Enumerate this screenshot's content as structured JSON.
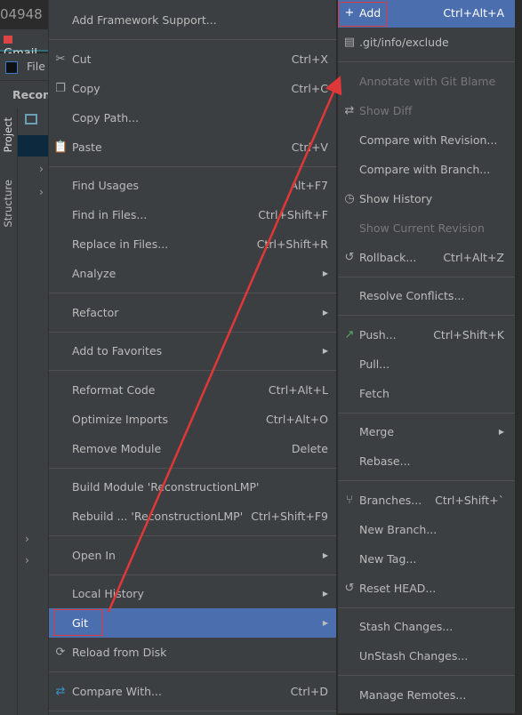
{
  "background": {
    "window_title_fragment": "04948",
    "browser_tab": "Gmail",
    "menubar_file": "File",
    "project_header": "Recons",
    "side_tab_project": "Project",
    "side_tab_structure": "Structure",
    "tree_root_fragment": "P"
  },
  "context_menu": {
    "items": [
      {
        "label": "Add Framework Support..."
      },
      {
        "sep": true
      },
      {
        "label": "Cut",
        "shortcut": "Ctrl+X",
        "icon": "scissors-icon",
        "glyph": "✂"
      },
      {
        "label": "Copy",
        "shortcut": "Ctrl+C",
        "icon": "copy-icon",
        "glyph": "❐"
      },
      {
        "label": "Copy Path..."
      },
      {
        "label": "Paste",
        "shortcut": "Ctrl+V",
        "icon": "clipboard-icon",
        "glyph": "📋"
      },
      {
        "sep": true
      },
      {
        "label": "Find Usages",
        "shortcut": "Alt+F7"
      },
      {
        "label": "Find in Files...",
        "shortcut": "Ctrl+Shift+F"
      },
      {
        "label": "Replace in Files...",
        "shortcut": "Ctrl+Shift+R"
      },
      {
        "label": "Analyze",
        "submenu": true
      },
      {
        "sep": true
      },
      {
        "label": "Refactor",
        "submenu": true
      },
      {
        "sep": true
      },
      {
        "label": "Add to Favorites",
        "submenu": true
      },
      {
        "sep": true
      },
      {
        "label": "Reformat Code",
        "shortcut": "Ctrl+Alt+L"
      },
      {
        "label": "Optimize Imports",
        "shortcut": "Ctrl+Alt+O"
      },
      {
        "label": "Remove Module",
        "shortcut": "Delete"
      },
      {
        "sep": true
      },
      {
        "label": "Build Module 'ReconstructionLMP'"
      },
      {
        "label": "Rebuild ... 'ReconstructionLMP'",
        "shortcut": "Ctrl+Shift+F9"
      },
      {
        "sep": true
      },
      {
        "label": "Open In",
        "submenu": true
      },
      {
        "sep": true
      },
      {
        "label": "Local History",
        "submenu": true
      },
      {
        "label": "Git",
        "submenu": true,
        "highlighted": true
      },
      {
        "label": "Reload from Disk",
        "icon": "reload-icon",
        "glyph": "⟳"
      },
      {
        "sep": true
      },
      {
        "label": "Compare With...",
        "shortcut": "Ctrl+D",
        "icon": "compare-icon",
        "glyph": "⇄",
        "glyph_color": "#3592c4"
      },
      {
        "sep": true
      }
    ]
  },
  "git_submenu": {
    "items": [
      {
        "label": "Add",
        "shortcut": "Ctrl+Alt+A",
        "icon": "plus-icon",
        "glyph": "+",
        "highlighted": true
      },
      {
        "label": ".git/info/exclude",
        "icon": "ignore-file-icon",
        "glyph": "▤"
      },
      {
        "sep": true
      },
      {
        "label": "Annotate with Git Blame",
        "disabled": true
      },
      {
        "label": "Show Diff",
        "disabled": true,
        "icon": "diff-icon",
        "glyph": "⇄"
      },
      {
        "label": "Compare with Revision..."
      },
      {
        "label": "Compare with Branch..."
      },
      {
        "label": "Show History",
        "icon": "clock-icon",
        "glyph": "◷"
      },
      {
        "label": "Show Current Revision",
        "disabled": true
      },
      {
        "label": "Rollback...",
        "shortcut": "Ctrl+Alt+Z",
        "icon": "undo-icon",
        "glyph": "↺"
      },
      {
        "sep": true
      },
      {
        "label": "Resolve Conflicts..."
      },
      {
        "sep": true
      },
      {
        "label": "Push...",
        "shortcut": "Ctrl+Shift+K",
        "icon": "push-arrow-icon",
        "glyph": "↗",
        "glyph_color": "#59a869"
      },
      {
        "label": "Pull..."
      },
      {
        "label": "Fetch"
      },
      {
        "sep": true
      },
      {
        "label": "Merge",
        "submenu": true
      },
      {
        "label": "Rebase..."
      },
      {
        "sep": true
      },
      {
        "label": "Branches...",
        "shortcut": "Ctrl+Shift+`",
        "icon": "branch-icon",
        "glyph": "⑂"
      },
      {
        "label": "New Branch..."
      },
      {
        "label": "New Tag..."
      },
      {
        "label": "Reset HEAD...",
        "icon": "undo-icon",
        "glyph": "↺"
      },
      {
        "sep": true
      },
      {
        "label": "Stash Changes..."
      },
      {
        "label": "UnStash Changes..."
      },
      {
        "sep": true
      },
      {
        "label": "Manage Remotes..."
      }
    ]
  },
  "colors": {
    "menu_bg": "#3c3f41",
    "highlight": "#4b6eaf",
    "annotation_red": "#e03838"
  }
}
